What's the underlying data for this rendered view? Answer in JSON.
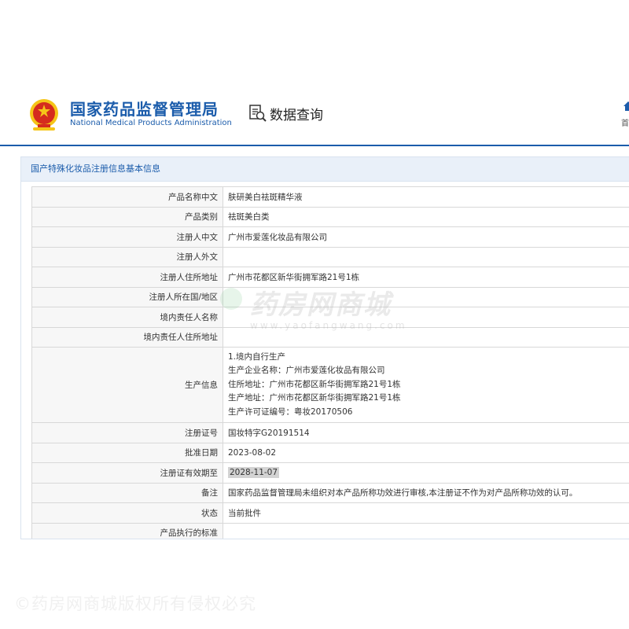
{
  "header": {
    "org_name_cn": "国家药品监督管理局",
    "org_name_en": "National Medical Products Administration",
    "query_label": "数据查询",
    "home_label": "首"
  },
  "panel": {
    "title": "国产特殊化妆品注册信息基本信息"
  },
  "rows": [
    {
      "label": "产品名称中文",
      "value": "肤研美白祛斑精华液"
    },
    {
      "label": "产品类别",
      "value": "祛斑美白类"
    },
    {
      "label": "注册人中文",
      "value": "广州市爱莲化妆品有限公司"
    },
    {
      "label": "注册人外文",
      "value": ""
    },
    {
      "label": "注册人住所地址",
      "value": "广州市花都区新华街拥军路21号1栋"
    },
    {
      "label": "注册人所在国/地区",
      "value": ""
    },
    {
      "label": "境内责任人名称",
      "value": ""
    },
    {
      "label": "境内责任人住所地址",
      "value": ""
    }
  ],
  "production": {
    "label": "生产信息",
    "lines": [
      "1.境内自行生产",
      "生产企业名称：广州市爱莲化妆品有限公司",
      "住所地址：广州市花都区新华街拥军路21号1栋",
      "生产地址：广州市花都区新华街拥军路21号1栋",
      "生产许可证编号：粤妆20170506"
    ]
  },
  "rows2": [
    {
      "label": "注册证号",
      "value": "国妆特字G20191514"
    },
    {
      "label": "批准日期",
      "value": "2023-08-02"
    },
    {
      "label": "注册证有效期至",
      "value": "2028-11-07"
    },
    {
      "label": "备注",
      "value": "国家药品监督管理局未组织对本产品所称功效进行审核,本注册证不作为对产品所称功效的认可。"
    },
    {
      "label": "状态",
      "value": "当前批件"
    },
    {
      "label": "产品执行的标准",
      "value": ""
    }
  ],
  "watermark": {
    "text_cn": "药房网商城",
    "text_en": "www.yaofangwang.com"
  },
  "copyright": "©药房网商城版权所有侵权必究",
  "colors": {
    "brand_blue": "#1b5cab",
    "emblem_red": "#d52b1e",
    "emblem_gold": "#f5c518"
  }
}
